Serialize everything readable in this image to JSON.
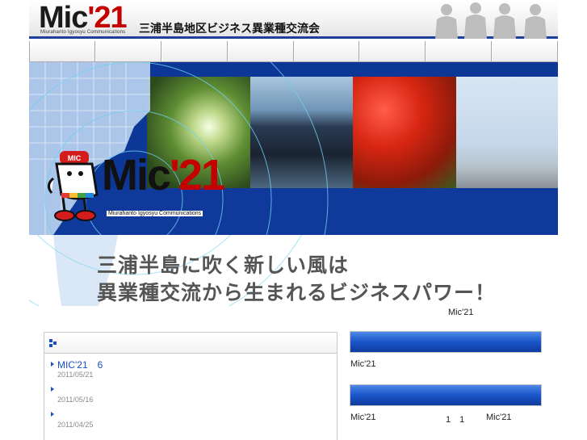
{
  "header": {
    "logo_main": "Mic",
    "logo_accent": "'21",
    "logo_sub": "Miurahanto Igyosyu Communications",
    "org_title": "三浦半島地区ビジネス異業種交流会"
  },
  "nav": {
    "items": [
      "",
      "",
      "",
      "",
      "",
      "",
      "",
      ""
    ]
  },
  "hero": {
    "brand_main": "Mic",
    "brand_accent": "'21",
    "brand_sub": "Miurahanto Igyosyu Communications",
    "mascot_badge": "MIC"
  },
  "tagline": {
    "line1": "三浦半島に吹く新しい風は",
    "line2": "異業種交流から生まれるビジネスパワー！"
  },
  "content": {
    "mic21_label": "Mic'21",
    "news": [
      {
        "title": "MIC'21　6",
        "date": "2011/05/21"
      },
      {
        "title": "",
        "date": "2011/05/16"
      },
      {
        "title": "",
        "date": "2011/04/25"
      }
    ],
    "side1_text": "Mic'21",
    "side2_text_a": "Mic'21",
    "side2_text_b": "1　1",
    "side2_text_c": "Mic'21"
  },
  "colors": {
    "brand_blue": "#0d3796",
    "accent_red": "#c40000",
    "link_blue": "#1a50c6"
  }
}
